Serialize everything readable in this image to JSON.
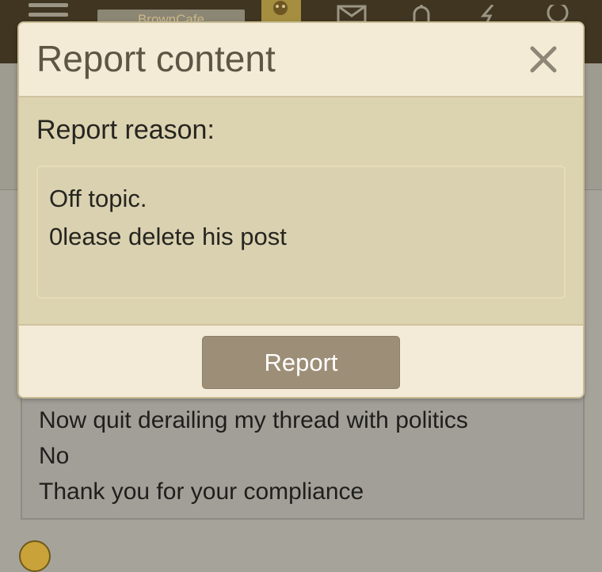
{
  "app": {
    "site_name": "BrownCafe"
  },
  "background": {
    "post_lines": [
      "Now quit derailing my thread with politics",
      "No",
      "Thank you for your compliance"
    ]
  },
  "modal": {
    "title": "Report content",
    "close_icon": "close-icon",
    "reason_label": "Report reason:",
    "reason_value": "Off topic.\n0lease delete his post",
    "submit_label": "Report"
  },
  "colors": {
    "header_bar": "#3f3520",
    "modal_body": "#dcd3b1",
    "button": "#9d8e77"
  }
}
